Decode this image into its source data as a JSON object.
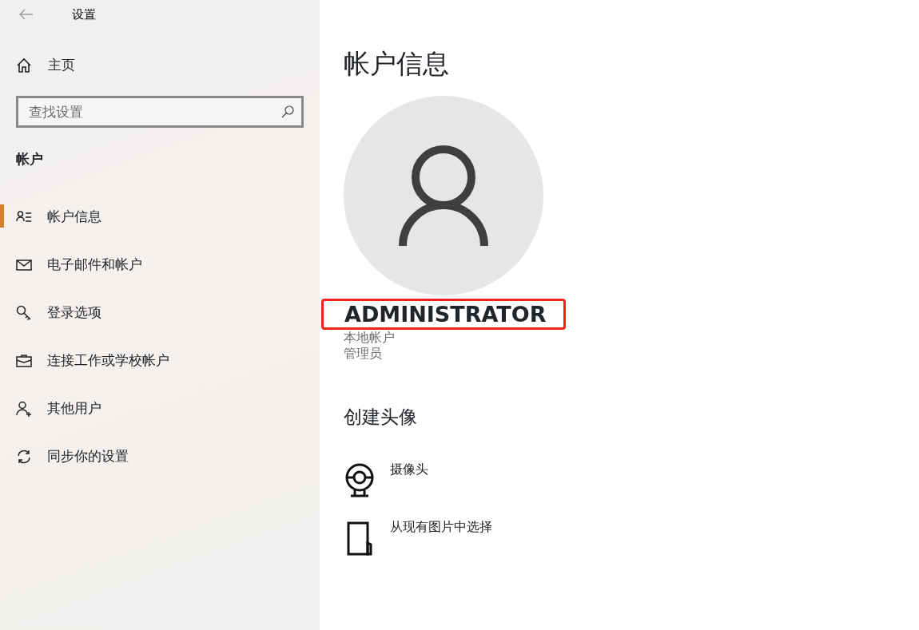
{
  "window": {
    "title": "设置"
  },
  "sidebar": {
    "home": "主页",
    "search": {
      "placeholder": "查找设置"
    },
    "section": "帐户",
    "items": [
      {
        "kind": "profile",
        "label": "帐户信息",
        "selected": true
      },
      {
        "kind": "mail",
        "label": "电子邮件和帐户",
        "selected": false
      },
      {
        "kind": "key",
        "label": "登录选项",
        "selected": false
      },
      {
        "kind": "briefcase",
        "label": "连接工作或学校帐户",
        "selected": false
      },
      {
        "kind": "adduser",
        "label": "其他用户",
        "selected": false
      },
      {
        "kind": "sync",
        "label": "同步你的设置",
        "selected": false
      }
    ]
  },
  "main": {
    "title": "帐户信息",
    "user": {
      "name": "ADMINISTRATOR",
      "highlighted": true,
      "details": [
        "本地帐户",
        "管理员"
      ]
    },
    "avatar_section": {
      "title": "创建头像",
      "options": [
        {
          "kind": "camera",
          "label": "摄像头"
        },
        {
          "kind": "file",
          "label": "从现有图片中选择"
        }
      ]
    }
  }
}
